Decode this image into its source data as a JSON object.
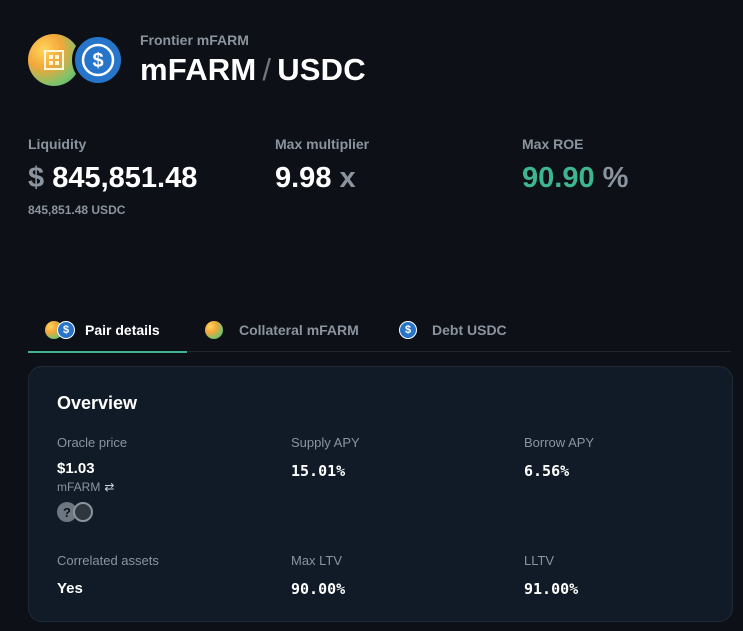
{
  "header": {
    "subtitle": "Frontier mFARM",
    "collateral": "mFARM",
    "separator": "/",
    "debt": "USDC"
  },
  "stats": {
    "liquidity": {
      "label": "Liquidity",
      "prefix": "$",
      "value": "845,851.48",
      "sub": "845,851.48 USDC"
    },
    "max_multiplier": {
      "label": "Max multiplier",
      "value": "9.98",
      "suffix": "x"
    },
    "max_roe": {
      "label": "Max ROE",
      "value": "90.90",
      "suffix": "%"
    }
  },
  "tabs": [
    {
      "label": "Pair details",
      "active": true
    },
    {
      "label": "Collateral mFARM",
      "active": false
    },
    {
      "label": "Debt USDC",
      "active": false
    }
  ],
  "overview": {
    "title": "Overview",
    "oracle_price": {
      "label": "Oracle price",
      "value": "$1.03",
      "unit": "mFARM",
      "swap_icon": "⇄",
      "icon1": "?"
    },
    "supply_apy": {
      "label": "Supply APY",
      "value": "15.01%"
    },
    "borrow_apy": {
      "label": "Borrow APY",
      "value": "6.56%"
    },
    "correlated_assets": {
      "label": "Correlated assets",
      "value": "Yes"
    },
    "max_ltv": {
      "label": "Max LTV",
      "value": "90.00%"
    },
    "lltv": {
      "label": "LLTV",
      "value": "91.00%"
    }
  },
  "colors": {
    "accent_green": "#3fb58f",
    "usdc_blue": "#2775ca",
    "background": "#0d1117",
    "card": "#111b27"
  },
  "icons": {
    "collateral": "mfarm-token-icon",
    "debt": "usdc-token-icon",
    "swap": "swap-icon"
  }
}
